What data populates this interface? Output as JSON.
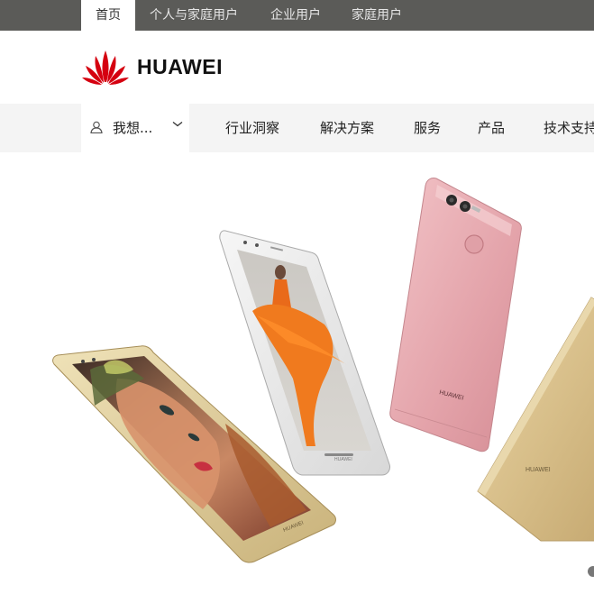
{
  "top_tabs": [
    "首页",
    "个人与家庭用户",
    "企业用户",
    "家庭用户"
  ],
  "logo": {
    "text": "HUAWEI",
    "icon": "huawei-petal-logo-icon",
    "color": "#d50010"
  },
  "main_nav": {
    "want_label": "我想...",
    "items": [
      "行业洞察",
      "解决方案",
      "服务",
      "产品",
      "技术支持"
    ]
  },
  "hero": {
    "phone1_brand": "HUAWEI",
    "phone2_brand": "HUAWEI",
    "phone3_brand": "HUAWEI",
    "phone4_brand": "HUAWEI"
  },
  "colors": {
    "topbar": "#5b5b58",
    "navbg": "#f4f4f4",
    "gold": "#d9c48f",
    "pink": "#e7a7ae",
    "silver": "#e3e3e3"
  }
}
